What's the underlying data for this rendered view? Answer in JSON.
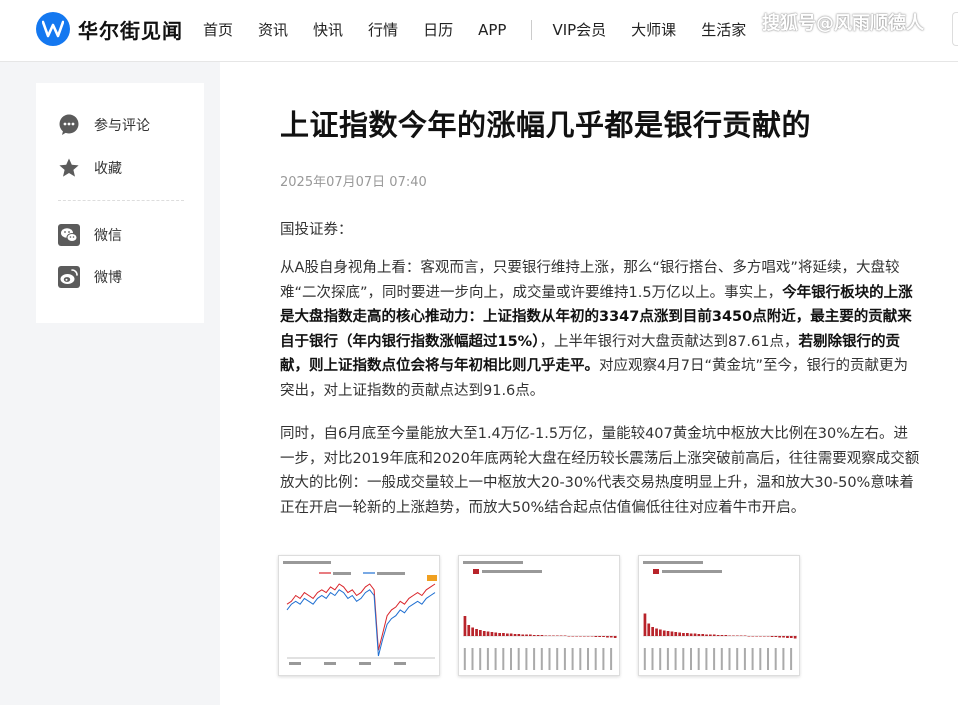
{
  "header": {
    "logo_text": "华尔街见闻",
    "nav": [
      "首页",
      "资讯",
      "快讯",
      "行情",
      "日历",
      "APP"
    ],
    "nav_extra": [
      "VIP会员",
      "大师课",
      "生活家"
    ],
    "watermark": "搜狐号@风雨顺德人"
  },
  "sidebar": {
    "items": [
      {
        "label": "参与评论",
        "icon": "comment-icon"
      },
      {
        "label": "收藏",
        "icon": "star-icon"
      },
      {
        "label": "微信",
        "icon": "wechat-icon"
      },
      {
        "label": "微博",
        "icon": "weibo-icon"
      }
    ]
  },
  "article": {
    "title": "上证指数今年的涨幅几乎都是银行贡献的",
    "date": "2025年07月07日 07:40",
    "source": "国投证券：",
    "p1": {
      "t1": "从A股自身视角上看：客观而言，只要银行维持上涨，那么“银行搭台、多方唱戏”将延续，大盘较难“二次探底”，同时要进一步向上，成交量或许要维持1.5万亿以上。事实上，",
      "b1": "今年银行板块的上涨是大盘指数走高的核心推动力：上证指数从年初的3347点涨到目前3450点附近，最主要的贡献来自于银行（年内银行指数涨幅超过15%）",
      "t2": "，上半年银行对大盘贡献达到87.61点，",
      "b2": "若剔除银行的贡献，则上证指数点位会将与年初相比则几乎走平。",
      "t3": "对应观察4月7日“黄金坑”至今，银行的贡献更为突出，对上证指数的贡献点达到91.6点。"
    },
    "p2": "同时，自6月底至今量能放大至1.4万亿-1.5万亿，量能较407黄金坑中枢放大比例在30%左右。进一步，对比2019年底和2020年底两轮大盘在经历较长震荡后上涨突破前高后，往往需要观察成交额放大的比例：一般成交量较上一中枢放大20-30%代表交易热度明显上升，温和放大30-50%意味着正在开启一轮新的上涨趋势，而放大50%结合起点估值偏低往往对应着牛市开启。"
  },
  "colors": {
    "brand": "#1478f0",
    "line_red": "#d9252b",
    "line_blue": "#1f6fd1",
    "bar_red": "#b8232a"
  },
  "chart_data": [
    {
      "type": "line",
      "series": [
        {
          "values": [
            2,
            3,
            5,
            4,
            6,
            5,
            4,
            6,
            7,
            6,
            8,
            7,
            9,
            8,
            6,
            7,
            5,
            6,
            8,
            9,
            7,
            -14,
            -8,
            -2,
            0,
            1,
            3,
            2,
            4,
            5,
            6,
            5,
            7,
            8,
            9
          ]
        },
        {
          "values": [
            0,
            2,
            3,
            2,
            4,
            3,
            2,
            4,
            5,
            4,
            6,
            5,
            7,
            6,
            4,
            5,
            3,
            4,
            6,
            7,
            5,
            -16,
            -10,
            -5,
            -3,
            -2,
            0,
            -1,
            1,
            2,
            3,
            2,
            4,
            5,
            6
          ]
        }
      ]
    },
    {
      "type": "bar",
      "values": [
        40,
        22,
        17,
        14,
        12,
        10,
        9,
        8,
        7,
        6,
        6,
        5,
        5,
        4,
        4,
        3,
        3,
        3,
        2,
        2,
        2,
        1,
        1,
        1,
        1,
        1,
        1,
        0,
        0,
        0,
        -1,
        -1,
        -1,
        -1,
        -2,
        -2,
        -2,
        -3,
        -3,
        -4
      ]
    },
    {
      "type": "bar",
      "values": [
        45,
        25,
        18,
        15,
        13,
        11,
        10,
        9,
        8,
        7,
        6,
        6,
        5,
        5,
        4,
        4,
        3,
        3,
        3,
        2,
        2,
        2,
        1,
        1,
        1,
        1,
        1,
        0,
        0,
        0,
        -1,
        -1,
        -1,
        -2,
        -2,
        -3,
        -3,
        -4,
        -4,
        -5
      ]
    }
  ]
}
